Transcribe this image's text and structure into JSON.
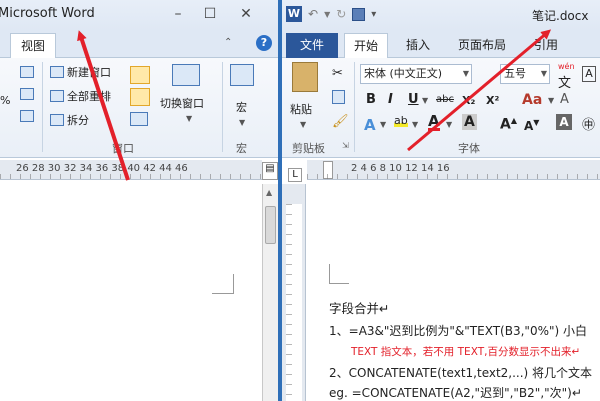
{
  "left_window": {
    "title": "Microsoft Word",
    "tab": "视图",
    "ribbon": {
      "new_window": "新建窗口",
      "arrange_all": "全部重排",
      "split": "拆分",
      "switch_windows": "切换窗口",
      "macros": "宏",
      "group_window": "窗口",
      "group_macros": "宏"
    },
    "ruler_numbers": "26   28   30   32   34   36   38   40   42   44   46"
  },
  "right_window": {
    "title": "笔记.docx",
    "tabs": {
      "file": "文件",
      "home": "开始",
      "insert": "插入",
      "page_layout": "页面布局",
      "references": "引用"
    },
    "ribbon": {
      "paste": "粘贴",
      "font_name": "宋体 (中文正文)",
      "font_size": "五号",
      "group_clipboard": "剪贴板",
      "group_font": "字体",
      "bold": "B",
      "italic": "I",
      "underline": "U",
      "strikethrough": "abc",
      "subscript": "X₂",
      "superscript": "X²",
      "grow": "A",
      "shrink": "A",
      "wen": "wén"
    },
    "ruler_numbers": "2   4   6   8   10   12   14   16"
  },
  "document": {
    "heading": "字段合并↵",
    "line1": "1、=A3&\"迟到比例为\"&\"TEXT(B3,\"0%\")     小白",
    "line1_note": "TEXT 指文本，若不用 TEXT,百分数显示不出来↵",
    "line2": "2、CONCATENATE(text1,text2,...)     将几个文本",
    "line3": "eg. =CONCATENATE(A2,\"迟到\",\"B2\",\"次\")↵"
  },
  "colors": {
    "accent": "#2b579a",
    "arrow": "#e3202a",
    "divider": "#2f6fb8"
  }
}
